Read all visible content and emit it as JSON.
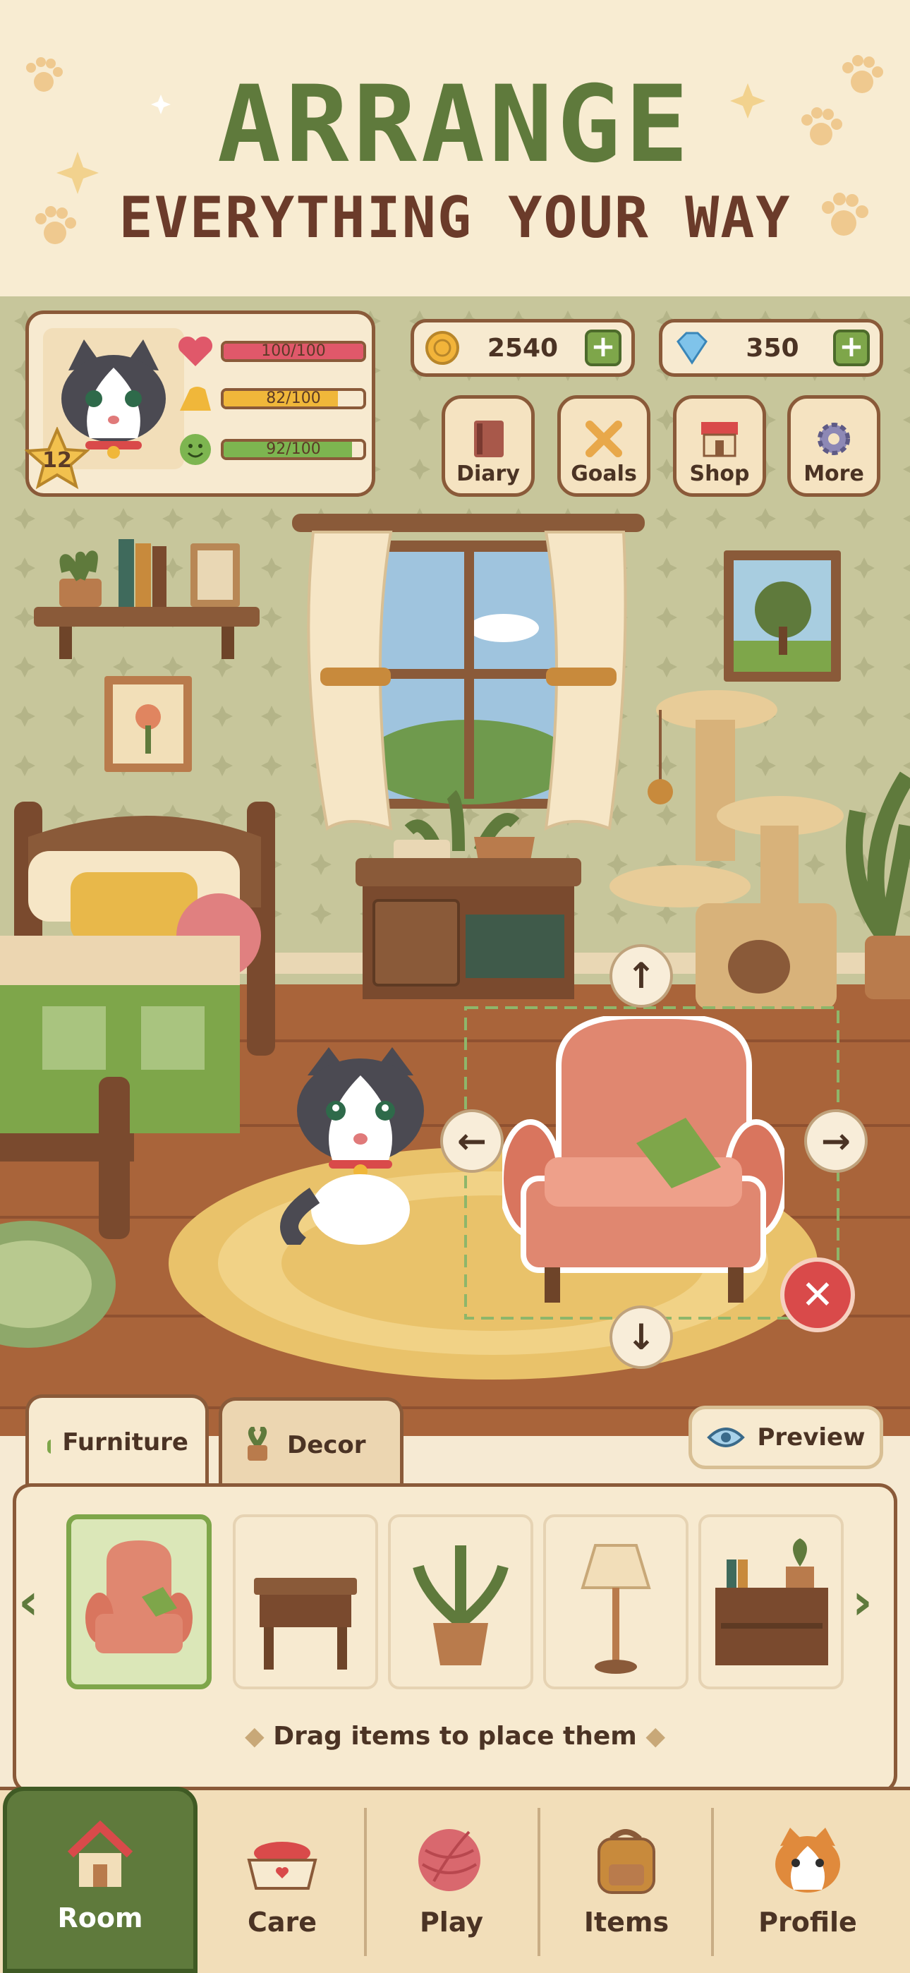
{
  "banner": {
    "title": "ARRANGE",
    "subtitle": "EVERYTHING YOUR WAY"
  },
  "profile": {
    "level": "12",
    "stats": [
      {
        "name": "heart-icon",
        "text": "100/100",
        "value": 1.0,
        "color": "#e0586a"
      },
      {
        "name": "food-icon",
        "text": "82/100",
        "value": 0.82,
        "color": "#f0b73a"
      },
      {
        "name": "smile-icon",
        "text": "92/100",
        "value": 0.92,
        "color": "#7db550"
      }
    ]
  },
  "currency": {
    "coins": "2540",
    "gems": "350"
  },
  "quick_actions": [
    {
      "label": "Diary",
      "icon": "book-icon"
    },
    {
      "label": "Goals",
      "icon": "bone-icon"
    },
    {
      "label": "Shop",
      "icon": "shop-icon"
    },
    {
      "label": "More",
      "icon": "gear-icon"
    }
  ],
  "tabs": [
    {
      "label": "Furniture",
      "icon": "sofa-icon",
      "active": true
    },
    {
      "label": "Decor",
      "icon": "plant-icon",
      "active": false
    }
  ],
  "preview_label": "Preview",
  "items": [
    "armchair",
    "side-table",
    "potted-plant",
    "floor-lamp",
    "bookshelf"
  ],
  "hint": "Drag items to place them",
  "nav": [
    {
      "label": "Room",
      "icon": "house-icon",
      "active": true
    },
    {
      "label": "Care",
      "icon": "bowl-icon",
      "active": false
    },
    {
      "label": "Play",
      "icon": "yarn-icon",
      "active": false
    },
    {
      "label": "Items",
      "icon": "backpack-icon",
      "active": false
    },
    {
      "label": "Profile",
      "icon": "cat-face-icon",
      "active": false
    }
  ],
  "colors": {
    "accent": "#5f7a3c",
    "wood": "#8a5a39",
    "panel": "#f7ead0",
    "delete": "#d94a4a"
  }
}
